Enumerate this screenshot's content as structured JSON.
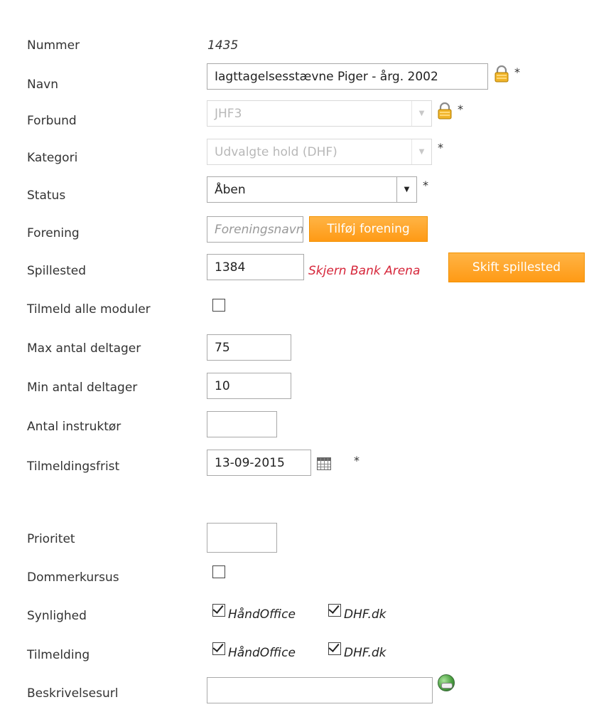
{
  "form": {
    "nummer": {
      "label": "Nummer",
      "value": "1435"
    },
    "navn": {
      "label": "Navn",
      "value": "Iagttagelsesstævne Piger - årg. 2002",
      "required": "*"
    },
    "forbund": {
      "label": "Forbund",
      "value": "JHF3",
      "required": "*"
    },
    "kategori": {
      "label": "Kategori",
      "value": "Udvalgte hold (DHF)",
      "required": "*"
    },
    "status": {
      "label": "Status",
      "value": "Åben",
      "required": "*"
    },
    "forening": {
      "label": "Forening",
      "placeholder": "Foreningsnavn",
      "button": "Tilføj forening"
    },
    "spillested": {
      "label": "Spillested",
      "value": "1384",
      "venue_name": "Skjern Bank Arena",
      "button": "Skift spillested"
    },
    "tilmeld_alle_moduler": {
      "label": "Tilmeld alle moduler",
      "checked": false
    },
    "max_antal": {
      "label": "Max antal deltager",
      "value": "75"
    },
    "min_antal": {
      "label": "Min antal deltager",
      "value": "10"
    },
    "antal_instruktor": {
      "label": "Antal instruktør",
      "value": ""
    },
    "tilmeldingsfrist": {
      "label": "Tilmeldingsfrist",
      "value": "13-09-2015",
      "required": "*"
    },
    "prioritet": {
      "label": "Prioritet",
      "value": ""
    },
    "dommerkursus": {
      "label": "Dommerkursus",
      "checked": false
    },
    "synlighed": {
      "label": "Synlighed",
      "options": [
        {
          "label": "HåndOffice",
          "checked": true
        },
        {
          "label": "DHF.dk",
          "checked": true
        }
      ]
    },
    "tilmelding": {
      "label": "Tilmelding",
      "options": [
        {
          "label": "HåndOffice",
          "checked": true
        },
        {
          "label": "DHF.dk",
          "checked": true
        }
      ]
    },
    "beskrivelsesurl": {
      "label": "Beskrivelsesurl",
      "value": ""
    }
  },
  "icons": {
    "lock": "lock-icon",
    "calendar": "calendar-icon",
    "globe": "globe-link-icon",
    "dropdown": "chevron-down-icon"
  },
  "colors": {
    "accent_button": "#ff9f1c",
    "venue_text": "#d6263a"
  }
}
